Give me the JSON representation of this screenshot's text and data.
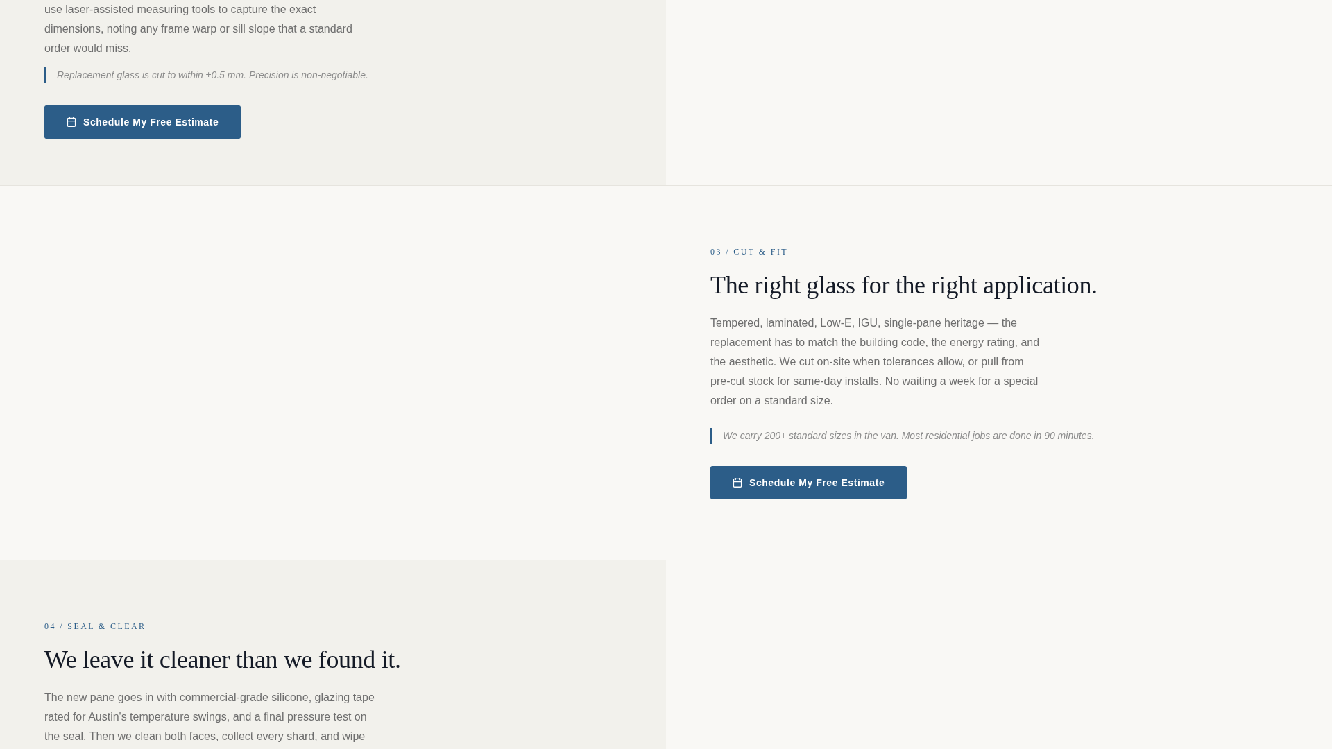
{
  "sections": [
    {
      "body": "use laser-assisted measuring tools to capture the exact dimensions, noting any frame warp or sill slope that a standard order would miss.",
      "note": "Replacement glass is cut to within ±0.5 mm. Precision is non-negotiable.",
      "button": "Schedule My Free Estimate"
    },
    {
      "eyebrow": "03 / CUT & FIT",
      "heading": "The right glass for the right application.",
      "body": "Tempered, laminated, Low-E, IGU, single-pane heritage — the replacement has to match the building code, the energy rating, and the aesthetic. We cut on-site when tolerances allow, or pull from pre-cut stock for same-day installs. No waiting a week for a special order on a standard size.",
      "note": "We carry 200+ standard sizes in the van. Most residential jobs are done in 90 minutes.",
      "button": "Schedule My Free Estimate"
    },
    {
      "eyebrow": "04 / SEAL & CLEAR",
      "heading": "We leave it cleaner than we found it.",
      "body": "The new pane goes in with commercial-grade silicone, glazing tape rated for Austin's temperature swings, and a final pressure test on the seal. Then we clean both faces, collect every shard, and wipe"
    }
  ]
}
